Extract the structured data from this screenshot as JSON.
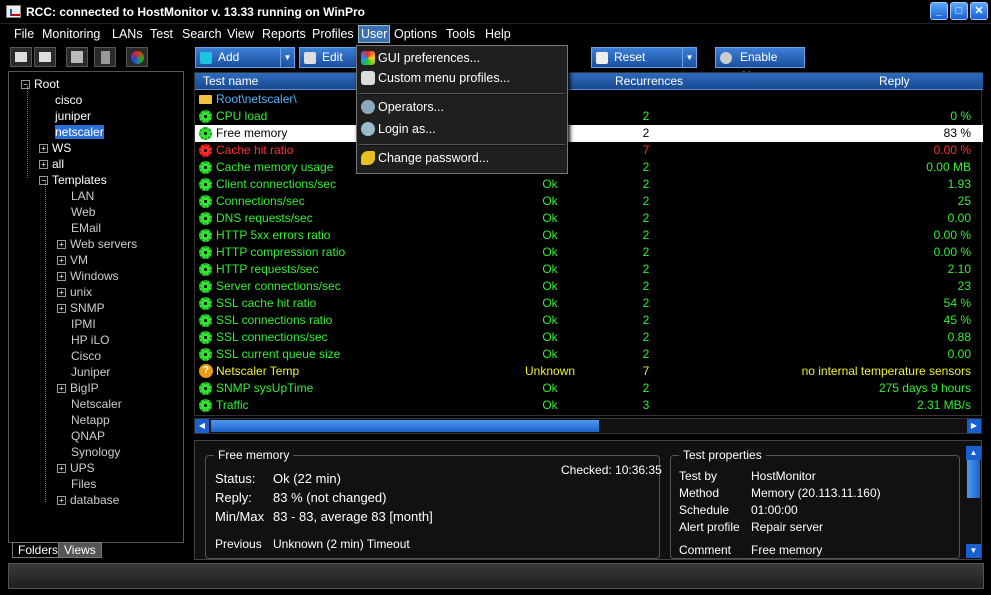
{
  "window": {
    "title": "RCC: connected to HostMonitor v. 13.33 running on WinPro"
  },
  "menu": [
    "File",
    "Monitoring",
    "LANs",
    "Test",
    "Search",
    "View",
    "Reports",
    "Profiles",
    "User",
    "Options",
    "Tools",
    "Help"
  ],
  "active_menu": "User",
  "toolbar": {
    "add": "Add",
    "edit": "Edit",
    "reset": "Reset",
    "enable_alerts": "Enable Alerts"
  },
  "user_menu": {
    "items": [
      "GUI preferences...",
      "Custom menu profiles...",
      "Operators...",
      "Login as...",
      "Change password..."
    ]
  },
  "tree": {
    "root": "Root",
    "children": [
      "cisco",
      "juniper",
      "netscaler"
    ],
    "selected": "netscaler",
    "ws": "WS",
    "all": "all",
    "templates": "Templates",
    "template_items": [
      "LAN",
      "Web",
      "EMail",
      "Web servers",
      "VM",
      "Windows",
      "unix",
      "SNMP",
      "IPMI",
      "HP iLO",
      "Cisco",
      "Juniper",
      "BigIP",
      "Netscaler",
      "Netapp",
      "QNAP",
      "Synology",
      "UPS",
      "Files",
      "database"
    ]
  },
  "tabs": {
    "folders": "Folders",
    "views": "Views"
  },
  "grid": {
    "columns": {
      "name": "Test name",
      "recurrences": "Recurrences",
      "reply": "Reply"
    },
    "folder_row": "Root\\netscaler\\",
    "rows": [
      {
        "name": "CPU load",
        "status": "",
        "rec": "2",
        "reply": "0 %",
        "state": "ok"
      },
      {
        "name": "Free memory",
        "status": "",
        "rec": "2",
        "reply": "83 %",
        "state": "selected"
      },
      {
        "name": "Cache hit ratio",
        "status": "",
        "rec": "7",
        "reply": "0.00 %",
        "state": "bad"
      },
      {
        "name": "Cache memory usage",
        "status": "",
        "rec": "2",
        "reply": "0.00 MB",
        "state": "ok"
      },
      {
        "name": "Client connections/sec",
        "status": "Ok",
        "rec": "2",
        "reply": "1.93",
        "state": "ok"
      },
      {
        "name": "Connections/sec",
        "status": "Ok",
        "rec": "2",
        "reply": "25",
        "state": "ok"
      },
      {
        "name": "DNS requests/sec",
        "status": "Ok",
        "rec": "2",
        "reply": "0.00",
        "state": "ok"
      },
      {
        "name": "HTTP 5xx errors ratio",
        "status": "Ok",
        "rec": "2",
        "reply": "0.00 %",
        "state": "ok"
      },
      {
        "name": "HTTP compression ratio",
        "status": "Ok",
        "rec": "2",
        "reply": "0.00 %",
        "state": "ok"
      },
      {
        "name": "HTTP requests/sec",
        "status": "Ok",
        "rec": "2",
        "reply": "2.10",
        "state": "ok"
      },
      {
        "name": "Server connections/sec",
        "status": "Ok",
        "rec": "2",
        "reply": "23",
        "state": "ok"
      },
      {
        "name": "SSL cache hit ratio",
        "status": "Ok",
        "rec": "2",
        "reply": "54 %",
        "state": "ok"
      },
      {
        "name": "SSL connections ratio",
        "status": "Ok",
        "rec": "2",
        "reply": "45 %",
        "state": "ok"
      },
      {
        "name": "SSL connections/sec",
        "status": "Ok",
        "rec": "2",
        "reply": "0.88",
        "state": "ok"
      },
      {
        "name": "SSL current queue size",
        "status": "Ok",
        "rec": "2",
        "reply": "0.00",
        "state": "ok"
      },
      {
        "name": "Netscaler Temp",
        "status": "Unknown",
        "rec": "7",
        "reply": "no internal temperature sensors",
        "state": "unk"
      },
      {
        "name": "SNMP sysUpTime",
        "status": "Ok",
        "rec": "2",
        "reply": "275 days 9 hours",
        "state": "ok"
      },
      {
        "name": "Traffic",
        "status": "Ok",
        "rec": "3",
        "reply": "2.31 MB/s",
        "state": "ok"
      }
    ]
  },
  "detail": {
    "group_title": "Free memory",
    "checked": "Checked: 10:36:35",
    "status_label": "Status:",
    "status_value": "Ok (22 min)",
    "reply_label": "Reply:",
    "reply_value": "83 %  (not changed)",
    "minmax_label": "Min/Max",
    "minmax_value": "83 - 83, average 83  [month]",
    "previous_label": "Previous",
    "previous_value": "Unknown (2 min)  Timeout"
  },
  "props": {
    "group_title": "Test properties",
    "rows": [
      {
        "label": "Test by",
        "value": "HostMonitor"
      },
      {
        "label": "Method",
        "value": "Memory (20.113.11.160)"
      },
      {
        "label": "Schedule",
        "value": "01:00:00"
      },
      {
        "label": "Alert profile",
        "value": "Repair server"
      },
      {
        "label": "Comment",
        "value": "Free memory"
      }
    ]
  },
  "colors": {
    "ok": "#33ee33",
    "bad": "#ff3030",
    "unknown": "#eeee33",
    "accent": "#2a6fd6"
  }
}
